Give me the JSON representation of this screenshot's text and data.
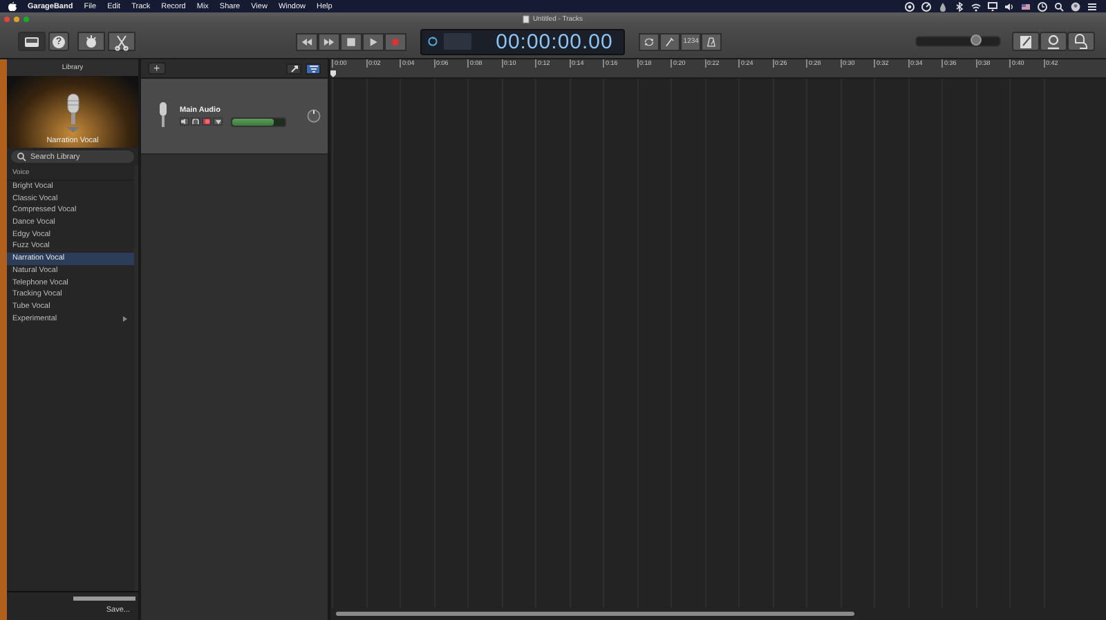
{
  "menubar": {
    "items": [
      {
        "label": "GarageBand",
        "kind": "app"
      },
      {
        "label": "File",
        "kind": "menu"
      },
      {
        "label": "Edit",
        "kind": "menu"
      },
      {
        "label": "Track",
        "kind": "menu"
      },
      {
        "label": "Record",
        "kind": "menu"
      },
      {
        "label": "Mix",
        "kind": "menu"
      },
      {
        "label": "Share",
        "kind": "menu"
      },
      {
        "label": "View",
        "kind": "menu"
      },
      {
        "label": "Window",
        "kind": "menu"
      },
      {
        "label": "Help",
        "kind": "menu"
      }
    ]
  },
  "window": {
    "title": "Untitled - Tracks"
  },
  "toolbar": {
    "left_buttons": [
      {
        "kind": "library",
        "selected": true
      },
      {
        "kind": "help",
        "selected": false,
        "label": "?"
      },
      {
        "kind": "smart",
        "selected": false
      },
      {
        "kind": "editors",
        "selected": false
      }
    ],
    "transport": [
      {
        "kind": "rewind"
      },
      {
        "kind": "forward"
      },
      {
        "kind": "stop"
      },
      {
        "kind": "play"
      },
      {
        "kind": "record"
      }
    ],
    "lcd": {
      "time": "00:00:00.00"
    },
    "mode_buttons": [
      {
        "kind": "cycle"
      },
      {
        "kind": "tuner"
      },
      {
        "kind": "count",
        "label": "1234"
      },
      {
        "kind": "metronome"
      }
    ],
    "master_volume": {
      "level": 0.72
    },
    "right_buttons": [
      {
        "kind": "notepad"
      },
      {
        "kind": "loops"
      },
      {
        "kind": "browser"
      }
    ]
  },
  "library": {
    "title": "Library",
    "patch_name": "Narration Vocal",
    "search": {
      "placeholder": "Search Library"
    },
    "category": "Voice",
    "items": [
      {
        "label": "Bright Vocal",
        "selected": false,
        "kind": "patch"
      },
      {
        "label": "Classic Vocal",
        "selected": false,
        "kind": "patch"
      },
      {
        "label": "Compressed Vocal",
        "selected": false,
        "kind": "patch"
      },
      {
        "label": "Dance Vocal",
        "selected": false,
        "kind": "patch"
      },
      {
        "label": "Edgy Vocal",
        "selected": false,
        "kind": "patch"
      },
      {
        "label": "Fuzz Vocal",
        "selected": false,
        "kind": "patch"
      },
      {
        "label": "Narration Vocal",
        "selected": true,
        "kind": "patch"
      },
      {
        "label": "Natural Vocal",
        "selected": false,
        "kind": "patch"
      },
      {
        "label": "Telephone Vocal",
        "selected": false,
        "kind": "patch"
      },
      {
        "label": "Tracking Vocal",
        "selected": false,
        "kind": "patch"
      },
      {
        "label": "Tube Vocal",
        "selected": false,
        "kind": "patch"
      },
      {
        "label": "Experimental",
        "selected": false,
        "kind": "folder"
      }
    ],
    "save_button": "Save..."
  },
  "tracks_header": {
    "add_button": "+",
    "buttons": [
      {
        "kind": "catch",
        "selected": false
      },
      {
        "kind": "filter",
        "selected": true
      }
    ]
  },
  "tracks": [
    {
      "name": "Main Audio",
      "muted": false,
      "solo": false,
      "record_enabled": true,
      "volume": {
        "level": 0.78
      }
    }
  ],
  "ruler": {
    "labels": [
      "0:00",
      "0:02",
      "0:04",
      "0:06",
      "0:08",
      "0:10",
      "0:12",
      "0:14",
      "0:16",
      "0:18",
      "0:20",
      "0:22",
      "0:24",
      "0:26",
      "0:28",
      "0:30",
      "0:32",
      "0:34",
      "0:36",
      "0:38",
      "0:40",
      "0:42"
    ]
  }
}
